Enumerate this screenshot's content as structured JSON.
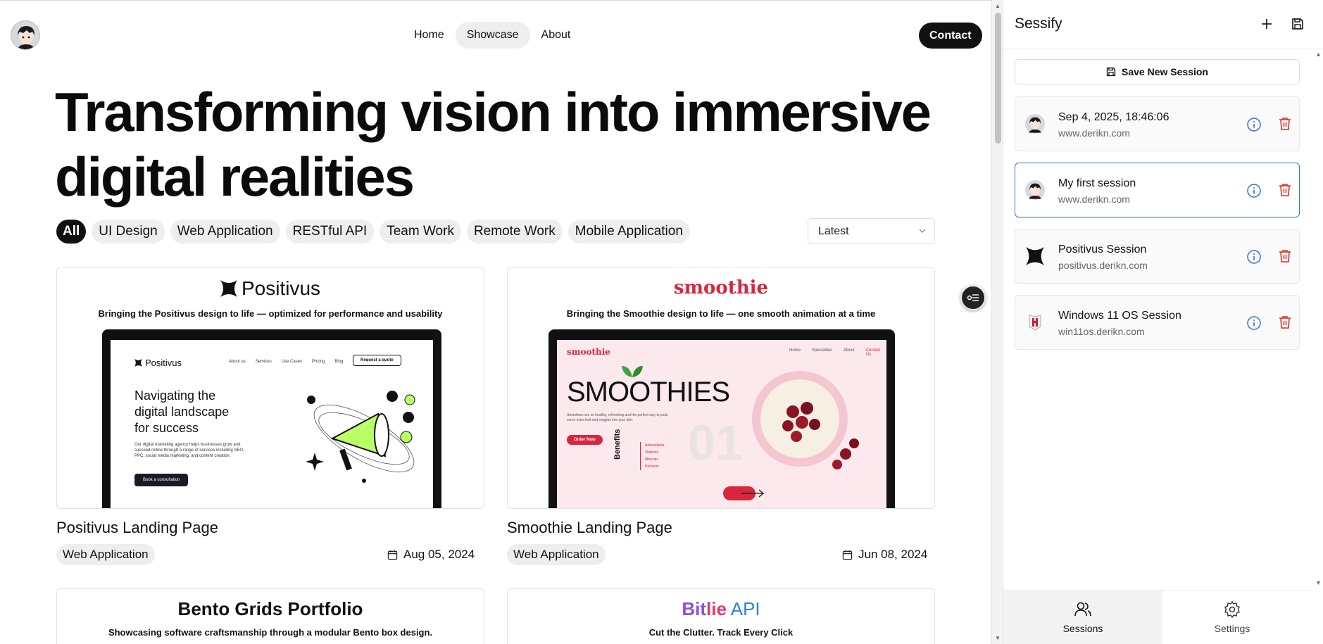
{
  "nav": {
    "home": "Home",
    "showcase": "Showcase",
    "about": "About",
    "contact": "Contact"
  },
  "hero": {
    "line1": "Transforming vision into immersive",
    "line2": "digital realities"
  },
  "filters": [
    "All",
    "UI Design",
    "Web Application",
    "RESTful API",
    "Team Work",
    "Remote Work",
    "Mobile Application"
  ],
  "sort": {
    "selected": "Latest"
  },
  "cards": [
    {
      "brand": "Positivus",
      "tagline": "Bringing the Positivus design to life — optimized for performance and usability",
      "title": "Positivus Landing Page",
      "category": "Web Application",
      "date": "Aug 05, 2024",
      "preview": {
        "logo": "Positivus",
        "links": [
          "About us",
          "Services",
          "Use Cases",
          "Pricing",
          "Blog"
        ],
        "cta": "Request a quote",
        "headline1": "Navigating the",
        "headline2": "digital landscape",
        "headline3": "for success",
        "body": "Our digital marketing agency helps businesses grow and succeed online through a range of services including SEO, PPC, social media marketing, and content creation.",
        "button": "Book a consultation"
      }
    },
    {
      "brand": "smoothie",
      "tagline": "Bringing the Smoothie design to life — one smooth animation at a time",
      "title": "Smoothie Landing Page",
      "category": "Web Application",
      "date": "Jun 08, 2024",
      "preview": {
        "logo": "smoothie",
        "links": [
          "Home",
          "Specialties",
          "About",
          "Contact Us"
        ],
        "headline": "SMOOTHIES",
        "body": "Smoothies are so healthy, refreshing and the perfect way to pack some extra fruit and veggies into your diet.",
        "button": "Order Now",
        "benefits_title": "Benefits",
        "benefits": [
          "Antioxidants",
          "Vitamins",
          "Minerals",
          "Nutrients"
        ],
        "number": "01"
      }
    },
    {
      "brand": "Bento Grids Portfolio",
      "tagline": "Showcasing software craftsmanship through a modular Bento box design."
    },
    {
      "brand_part1": "Bit",
      "brand_part2": "lie",
      "brand_part3": " API",
      "tagline": "Cut the Clutter. Track Every Click"
    }
  ],
  "sidebar": {
    "title": "Sessify",
    "save_new": "Save New Session",
    "sessions": [
      {
        "name": "Sep 4, 2025, 18:46:06",
        "url": "www.derikn.com",
        "icon": "avatar-icon"
      },
      {
        "name": "My first session",
        "url": "www.derikn.com",
        "icon": "avatar-icon"
      },
      {
        "name": "Positivus Session",
        "url": "positivus.derikn.com",
        "icon": "positivus-logo-icon"
      },
      {
        "name": "Windows 11 OS Session",
        "url": "win11os.derikn.com",
        "icon": "win11os-logo-icon"
      }
    ],
    "tabs": {
      "sessions": "Sessions",
      "settings": "Settings"
    }
  },
  "colors": {
    "accent_blue": "#2f6fde",
    "danger_red": "#d93025",
    "smoothie_red": "#d7263d",
    "positivus_green": "#b9ff66"
  }
}
